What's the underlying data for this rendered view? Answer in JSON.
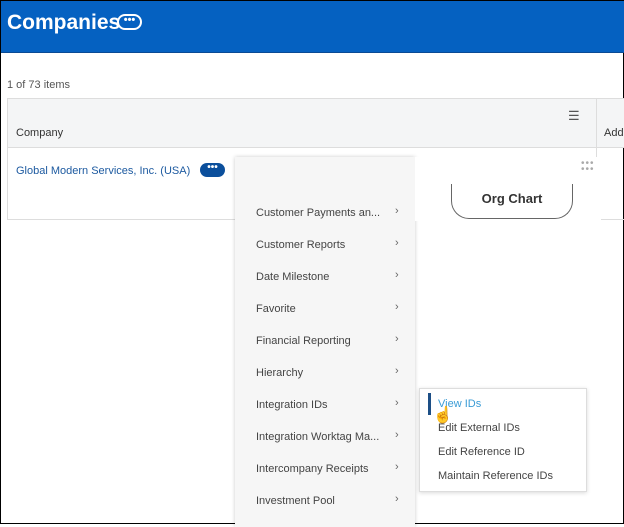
{
  "header": {
    "title": "Companies",
    "more_label": "•••"
  },
  "count_label": "1 of 73 items",
  "table": {
    "columns": [
      "Company",
      "Add"
    ],
    "rows": [
      {
        "company": "Global Modern Services, Inc. (USA)",
        "more_label": "•••"
      }
    ]
  },
  "menu": {
    "items": [
      "Customer Payments an...",
      "Customer Reports",
      "Date Milestone",
      "Favorite",
      "Financial Reporting",
      "Hierarchy",
      "Integration IDs",
      "Integration Worktag Ma...",
      "Intercompany Receipts",
      "Investment Pool"
    ],
    "chevron": "›"
  },
  "org_chart_label": "Org Chart",
  "submenu": {
    "items": [
      "View IDs",
      "Edit External IDs",
      "Edit Reference ID",
      "Maintain Reference IDs"
    ],
    "selected": "View IDs"
  },
  "colors": {
    "header": "#0561c1",
    "link": "#1d5aa0",
    "selected": "#3a9bd5"
  }
}
